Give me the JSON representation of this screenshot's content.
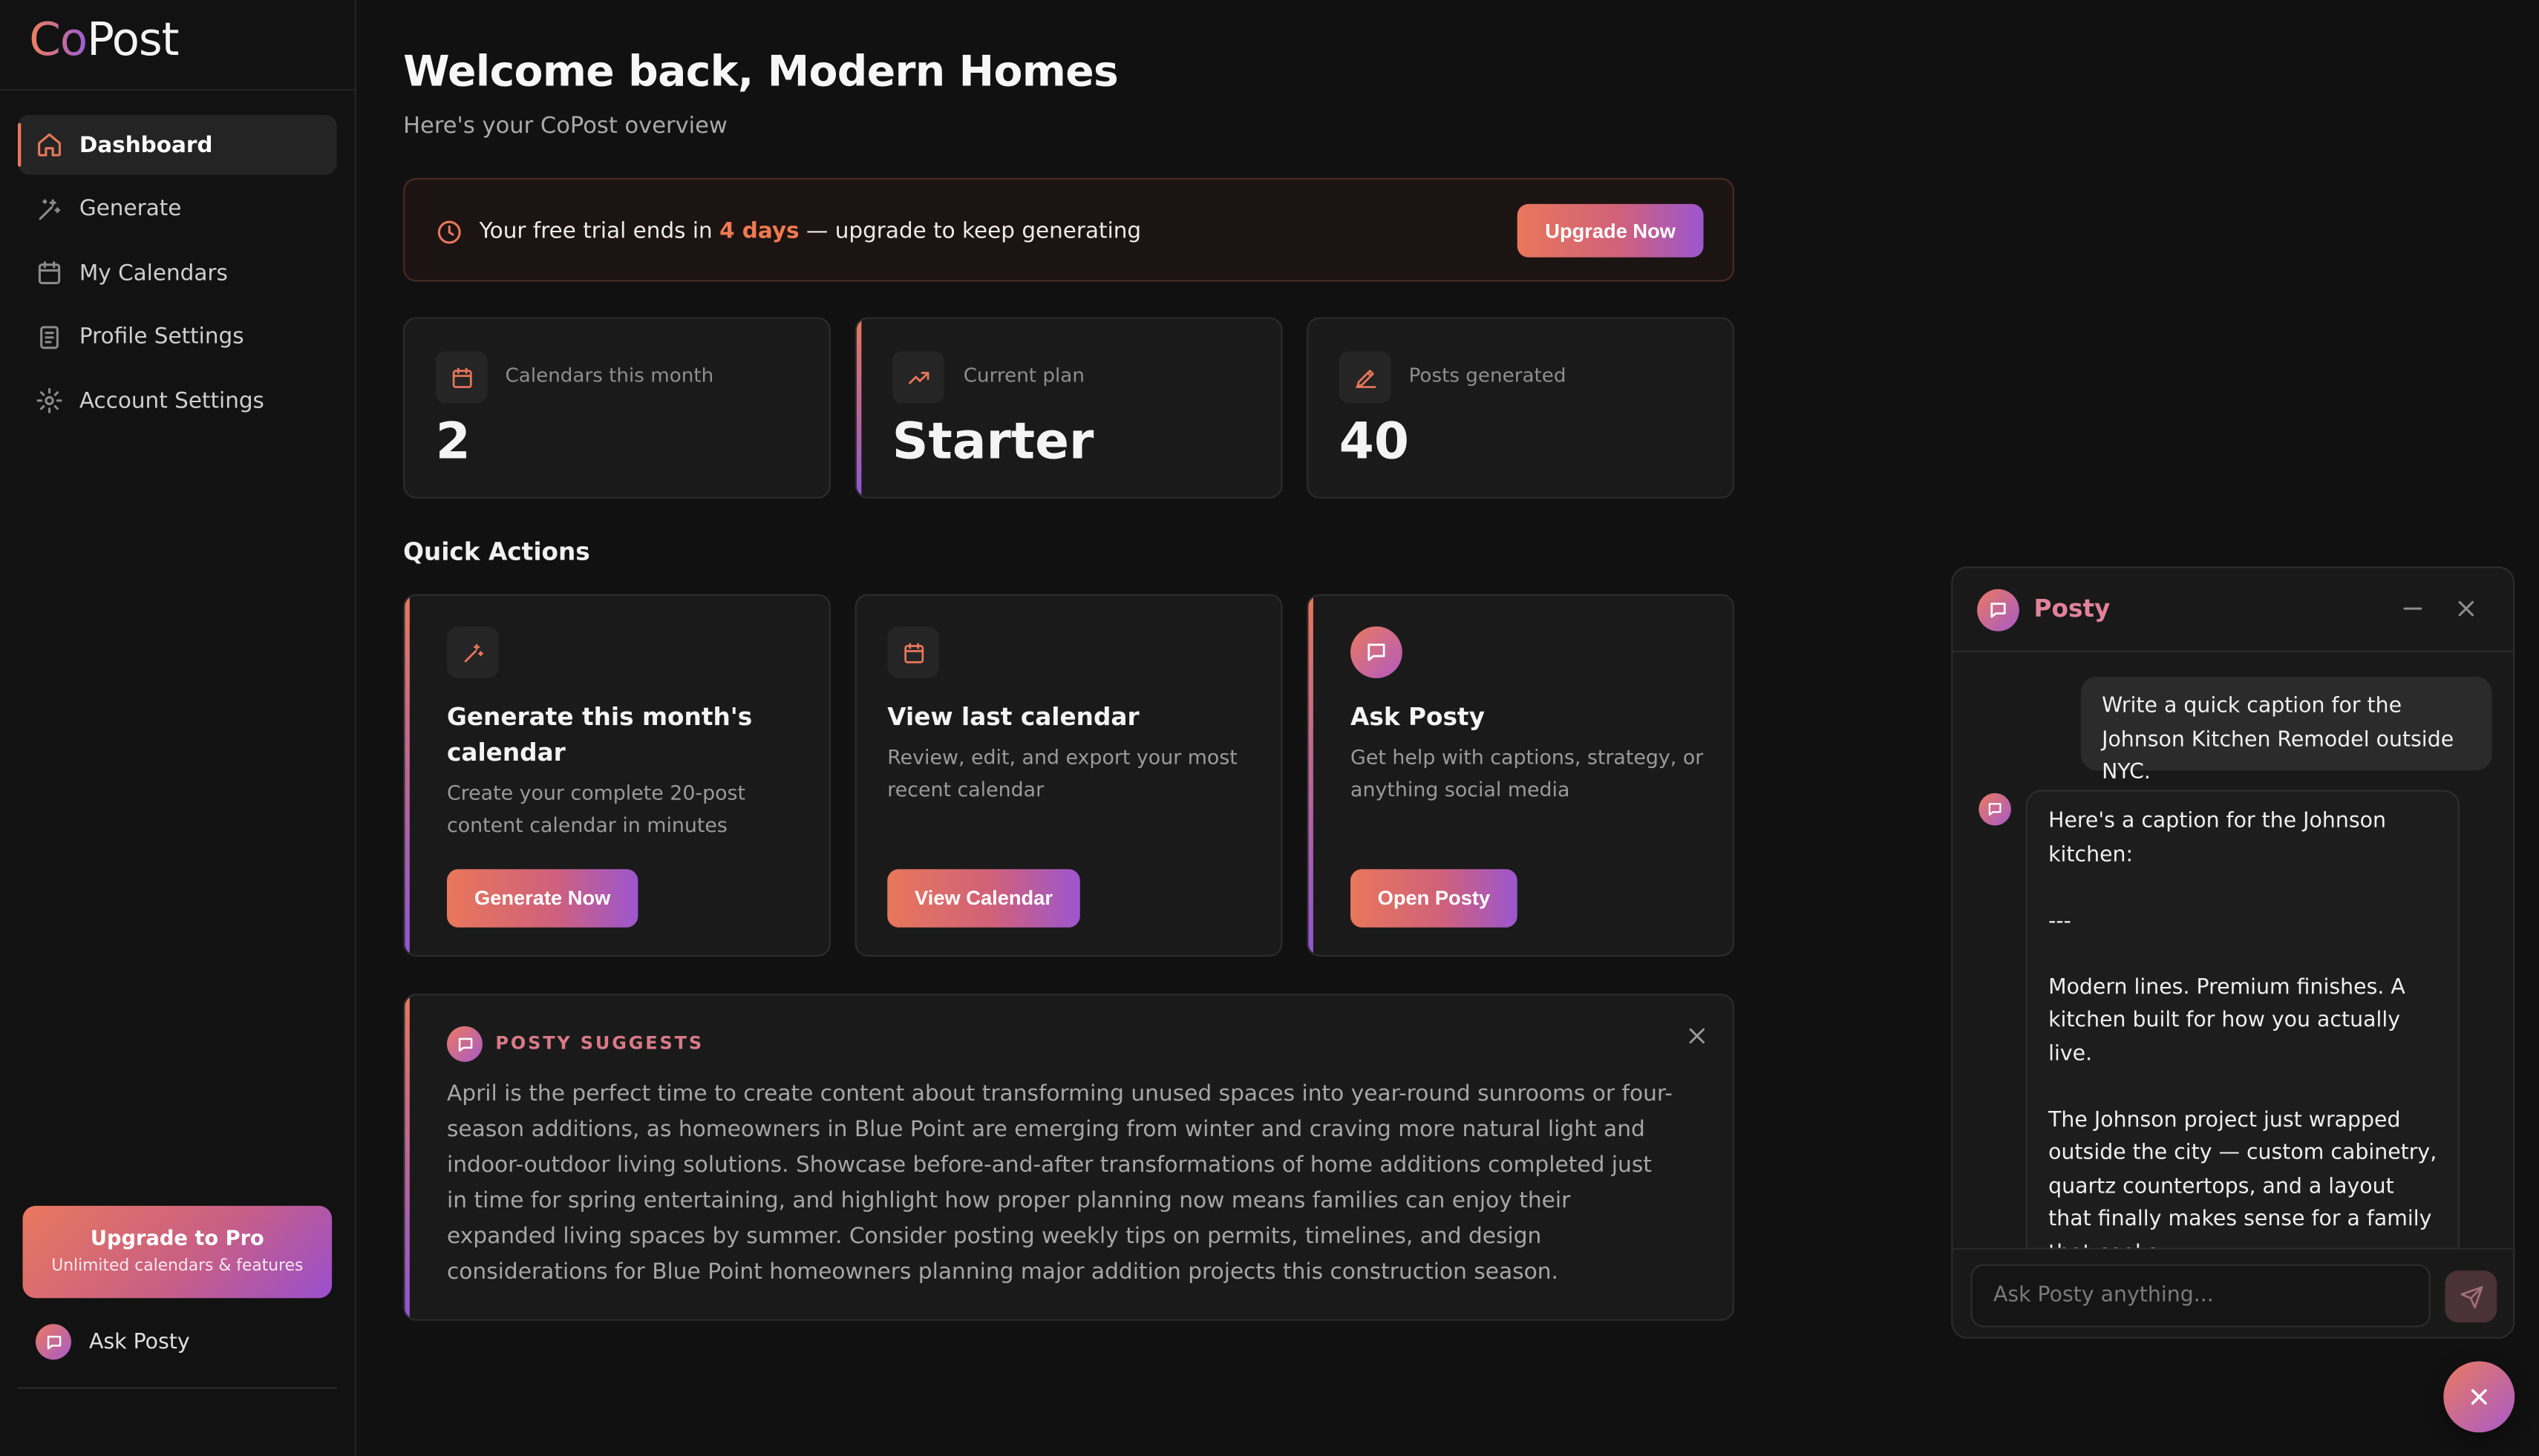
{
  "brand": {
    "logo_co": "Co",
    "logo_post": "Post"
  },
  "sidebar": {
    "items": [
      {
        "label": "Dashboard",
        "icon": "home-icon",
        "active": true
      },
      {
        "label": "Generate",
        "icon": "sparkle-icon"
      },
      {
        "label": "My Calendars",
        "icon": "calendar-icon"
      },
      {
        "label": "Profile Settings",
        "icon": "document-icon"
      },
      {
        "label": "Account Settings",
        "icon": "gear-icon"
      }
    ],
    "upgrade": {
      "title": "Upgrade to Pro",
      "subtitle": "Unlimited calendars & features"
    },
    "ask_posty": "Ask Posty"
  },
  "header": {
    "title": "Welcome back, Modern Homes",
    "subtitle": "Here's your CoPost overview"
  },
  "trial": {
    "prefix": "Your free trial ends in ",
    "days": "4 days",
    "suffix": " — upgrade to keep generating",
    "button": "Upgrade Now"
  },
  "stats": [
    {
      "label": "Calendars this month",
      "value": "2",
      "icon": "calendar-icon"
    },
    {
      "label": "Current plan",
      "value": "Starter",
      "icon": "trending-up-icon"
    },
    {
      "label": "Posts generated",
      "value": "40",
      "icon": "pen-icon"
    }
  ],
  "quick_actions": {
    "title": "Quick Actions",
    "cards": [
      {
        "title": "Generate this month's calendar",
        "description": "Create your complete 20-post content calendar in minutes",
        "button": "Generate Now"
      },
      {
        "title": "View last calendar",
        "description": "Review, edit, and export your most recent calendar",
        "button": "View Calendar"
      },
      {
        "title": "Ask Posty",
        "description": "Get help with captions, strategy, or anything social media",
        "button": "Open Posty"
      }
    ]
  },
  "suggestion": {
    "heading": "POSTY SUGGESTS",
    "body": "April is the perfect time to create content about transforming unused spaces into year-round sunrooms or four-season additions, as homeowners in Blue Point are emerging from winter and craving more natural light and indoor-outdoor living solutions. Showcase before-and-after transformations of home additions completed just in time for spring entertaining, and highlight how proper planning now means families can enjoy their expanded living spaces by summer. Consider posting weekly tips on permits, timelines, and design considerations for Blue Point homeowners planning major addition projects this construction season."
  },
  "chat": {
    "name": "Posty",
    "user_message": "Write a quick caption for the Johnson Kitchen Remodel outside NYC.",
    "bot_paragraphs": [
      "Here's a caption for the Johnson kitchen:",
      "---",
      "Modern lines. Premium finishes. A kitchen built for how you actually live.",
      "The Johnson project just wrapped outside the city — custom cabinetry, quartz countertops, and a layout that finally makes sense for a family that cooks."
    ],
    "input_placeholder": "Ask Posty anything..."
  },
  "colors": {
    "accent_orange": "#e8775b",
    "accent_purple": "#9c56cf",
    "background": "#111111",
    "card": "#1a1a1a"
  }
}
